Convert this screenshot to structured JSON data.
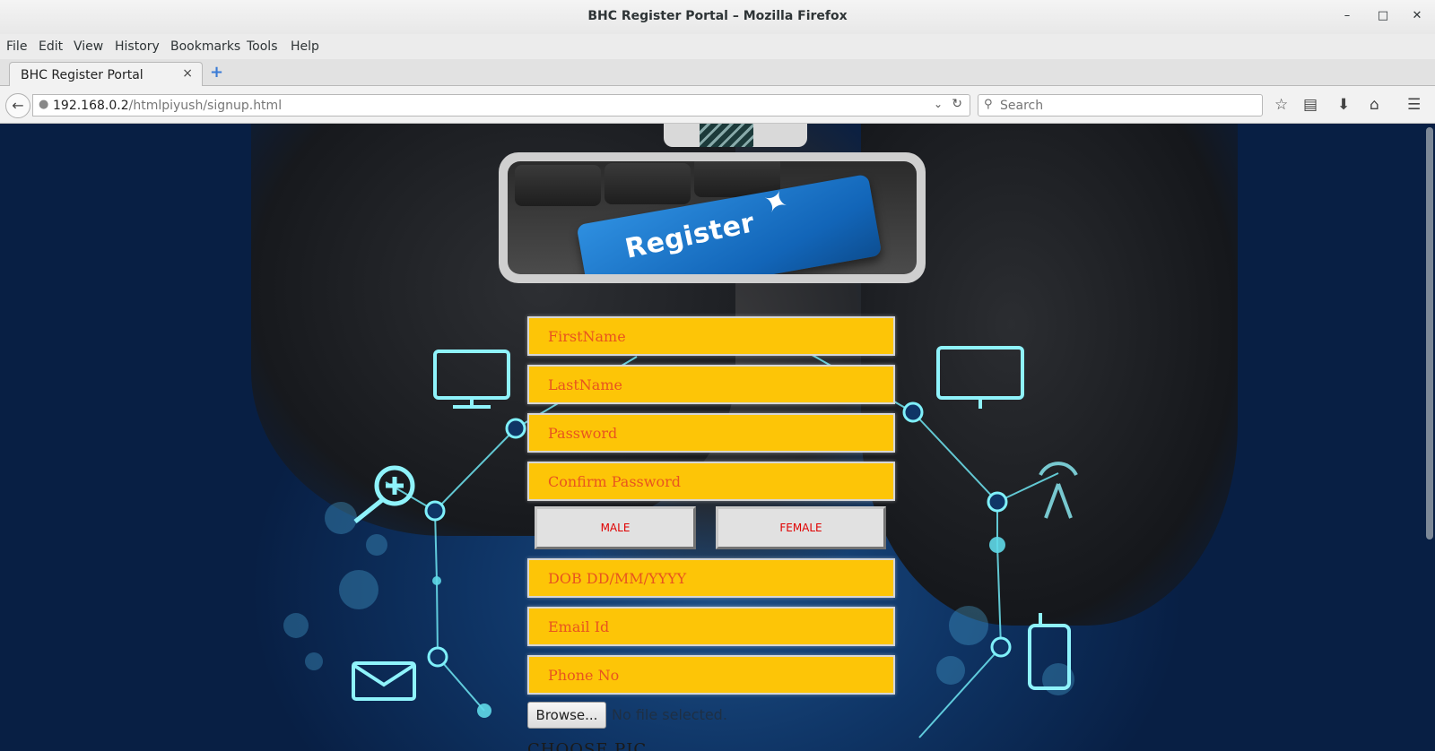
{
  "window": {
    "title": "BHC Register Portal – Mozilla Firefox",
    "minimize": "–",
    "maximize": "□",
    "close": "✕"
  },
  "menu": {
    "file": "File",
    "edit": "Edit",
    "view": "View",
    "history": "History",
    "bookmarks": "Bookmarks",
    "tools": "Tools",
    "help": "Help"
  },
  "tab": {
    "label": "BHC Register Portal",
    "close": "×",
    "new_tab": "+"
  },
  "navbar": {
    "url_host": "192.168.0.2",
    "url_path": "/htmlpiyush/signup.html",
    "search_placeholder": "Search",
    "icons": [
      "back-arrow-icon",
      "globe-icon",
      "dropdown-icon",
      "reload-icon",
      "search-icon",
      "star-icon",
      "reading-list-icon",
      "download-icon",
      "home-icon",
      "menu-icon"
    ]
  },
  "banner": {
    "key_text": "Register"
  },
  "form": {
    "firstname_placeholder": "FirstName",
    "lastname_placeholder": "LastName",
    "password_placeholder": "Password",
    "confirm_password_placeholder": "Confirm Password",
    "male_label": "MALE",
    "female_label": "FEMALE",
    "dob_placeholder": "DOB DD/MM/YYYY",
    "email_placeholder": "Email Id",
    "phone_placeholder": "Phone No",
    "browse_label": "Browse...",
    "no_file_text": "No file selected.",
    "choose_pic_label": "CHOOSE PIC"
  },
  "colors": {
    "field_bg": "#fdc507",
    "field_text": "#e8541f",
    "gender_text": "#e00000",
    "page_bg": "#0f3566"
  }
}
